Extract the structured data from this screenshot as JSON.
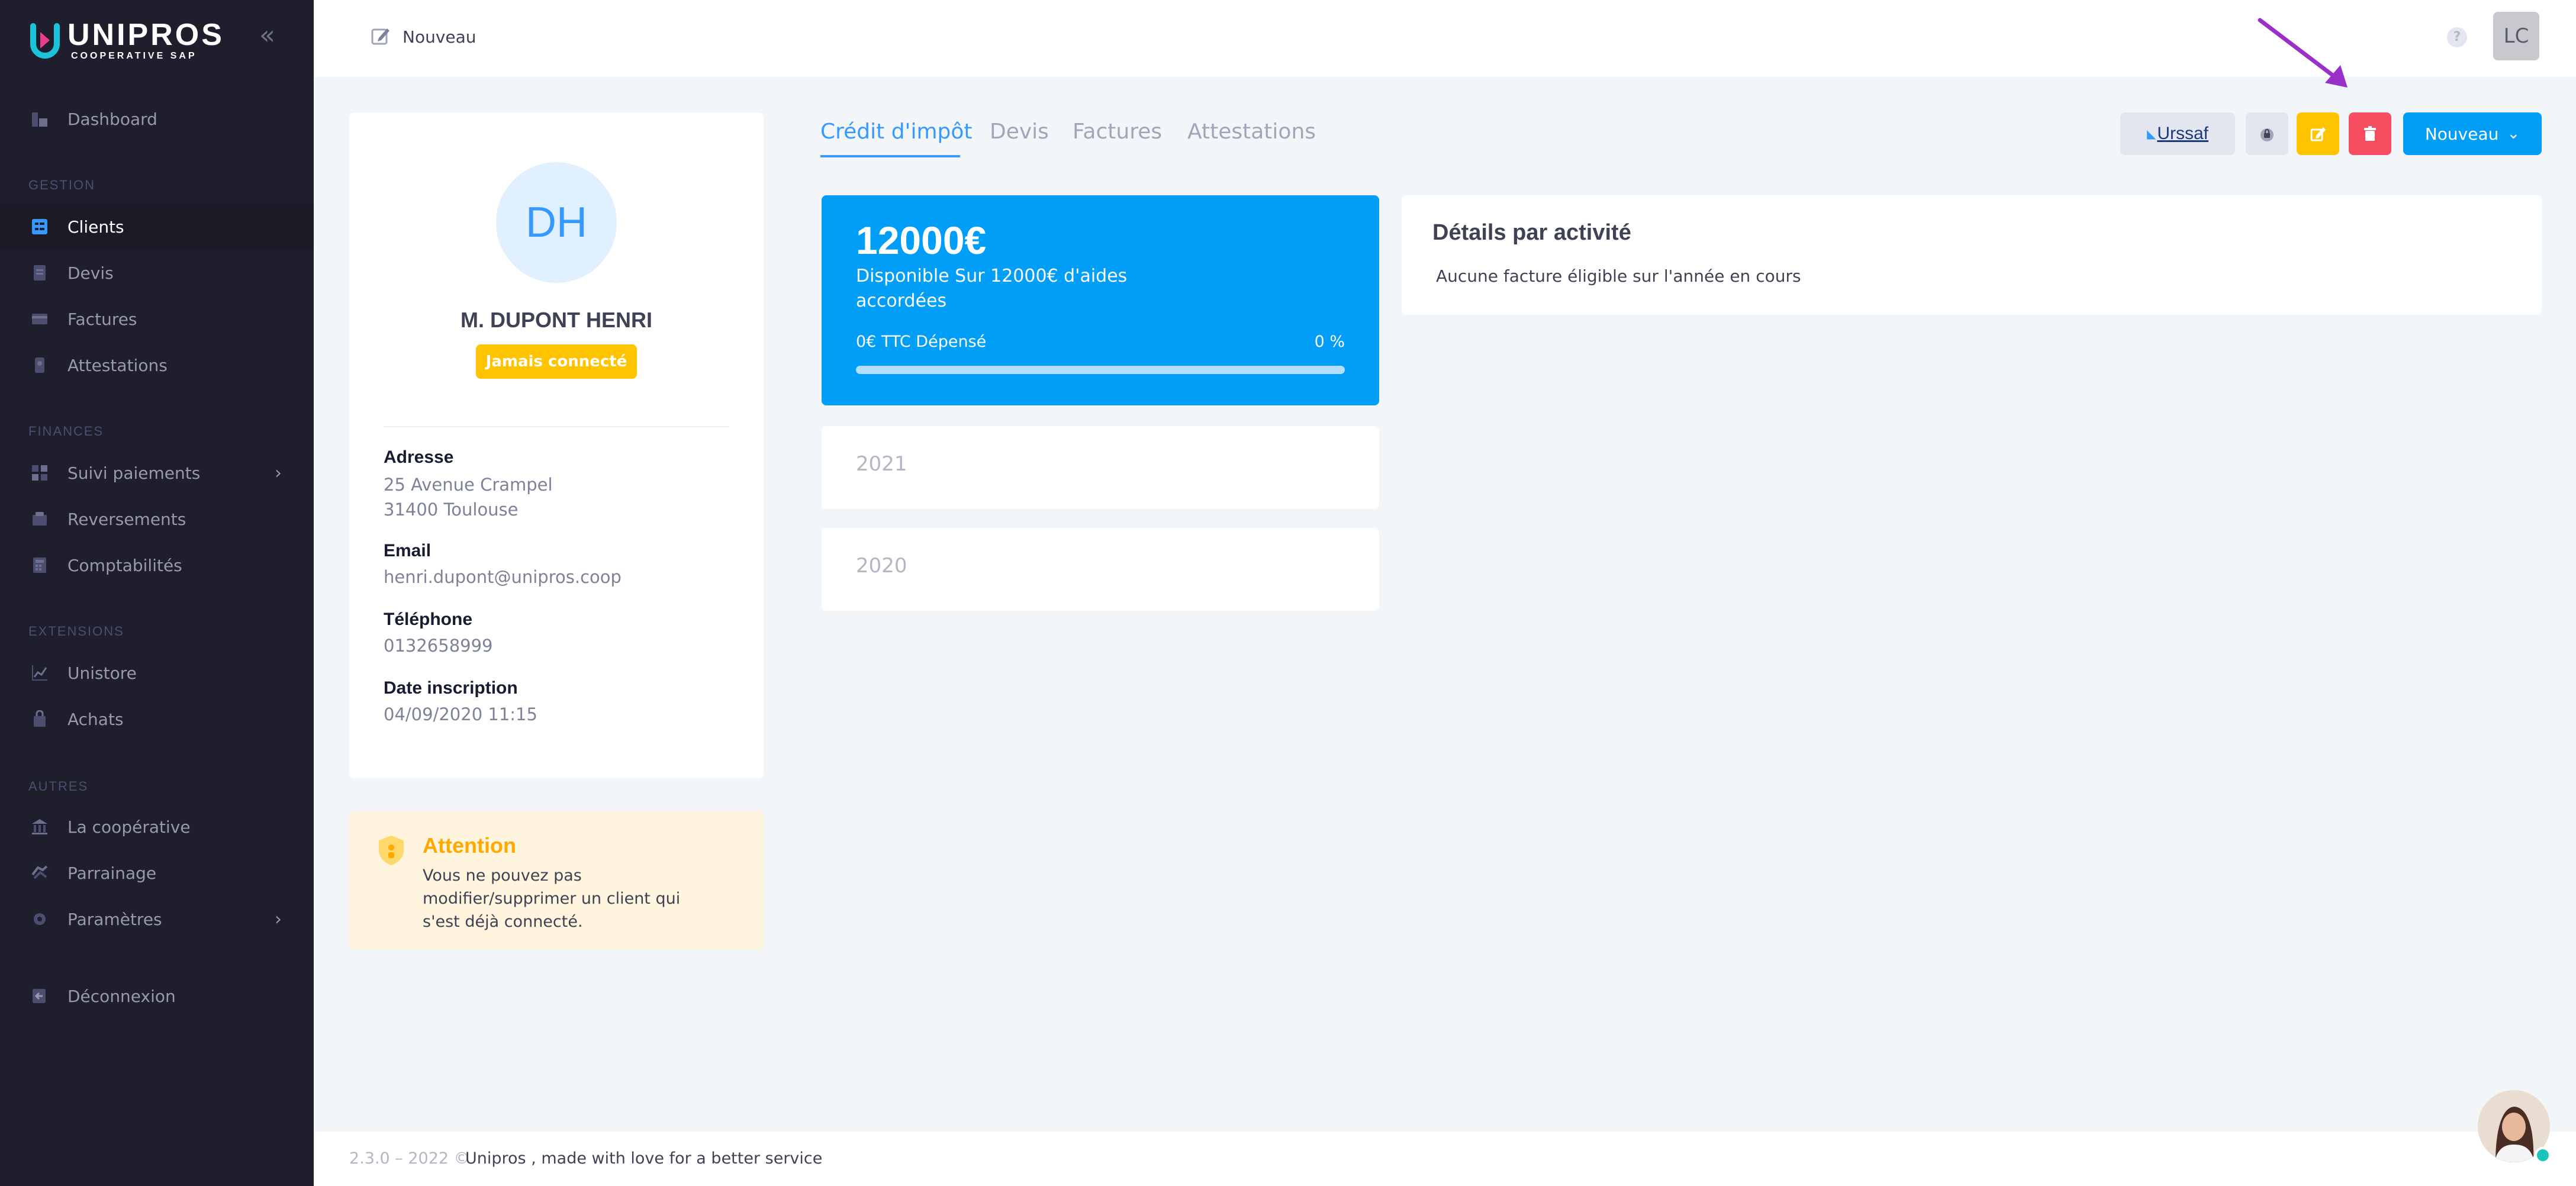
{
  "sidebar": {
    "brand": "UNIPROS",
    "brand_sub": "COOPERATIVE SAP",
    "sections": {
      "gestion": "GESTION",
      "finances": "FINANCES",
      "extensions": "EXTENSIONS",
      "autres": "AUTRES"
    },
    "items": {
      "dashboard": "Dashboard",
      "clients": "Clients",
      "devis": "Devis",
      "factures": "Factures",
      "attestations": "Attestations",
      "suivi": "Suivi paiements",
      "reversements": "Reversements",
      "comptabilites": "Comptabilités",
      "unistore": "Unistore",
      "achats": "Achats",
      "cooperative": "La coopérative",
      "parrainage": "Parrainage",
      "parametres": "Paramètres",
      "deconnexion": "Déconnexion"
    }
  },
  "header": {
    "label": "Nouveau",
    "help": "?",
    "user_initials": "LC"
  },
  "profile": {
    "initials": "DH",
    "name": "M. DUPONT HENRI",
    "status": "Jamais connecté",
    "address_label": "Adresse",
    "address_line1": "25 Avenue Crampel",
    "address_line2": "31400 Toulouse",
    "email_label": "Email",
    "email": "henri.dupont@unipros.coop",
    "phone_label": "Téléphone",
    "phone": "0132658999",
    "date_label": "Date inscription",
    "date": "04/09/2020 11:15"
  },
  "attention": {
    "title": "Attention",
    "text": "Vous ne pouvez pas modifier/supprimer un client qui s'est déjà connecté."
  },
  "tabs": {
    "credit": "Crédit d'impôt",
    "devis": "Devis",
    "factures": "Factures",
    "attestations": "Attestations"
  },
  "toolbar": {
    "urssaf": "Urssaf",
    "new_label": "Nouveau"
  },
  "credit": {
    "amount": "12000€",
    "available": "Disponible Sur 12000€ d'aides accordées",
    "spent": "0€ TTC Dépensé",
    "percent_label": "0 %",
    "progress": 0
  },
  "years": [
    "2021",
    "2020"
  ],
  "details": {
    "title": "Détails par activité",
    "empty": "Aucune facture éligible sur l'année en cours"
  },
  "footer": {
    "version": "2.3.0 – 2022 ©",
    "text": "Unipros , made with love for a better service"
  },
  "colors": {
    "primary": "#009ef7",
    "warning": "#ffc400",
    "danger": "#f64e60",
    "sidebar": "#1e1e2d",
    "annotation_arrow": "#9b2fc9"
  }
}
